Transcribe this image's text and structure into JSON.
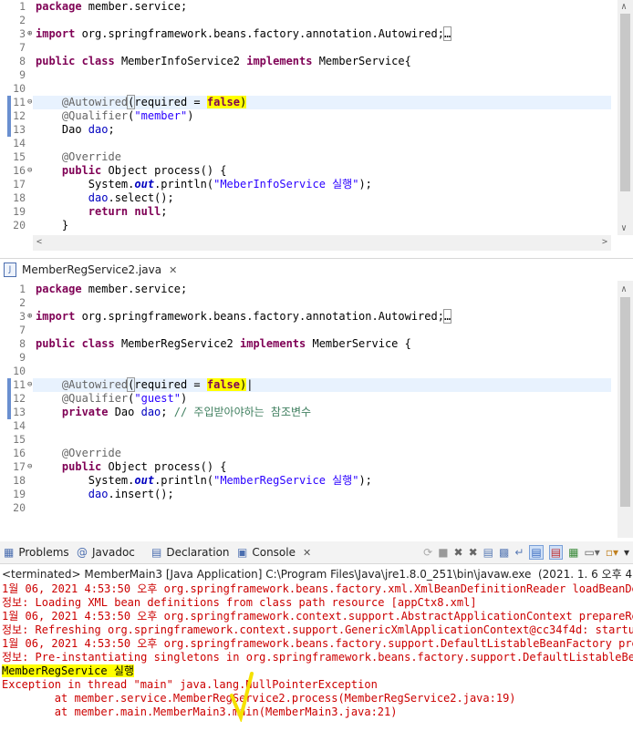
{
  "top_editor": {
    "lines": [
      {
        "n": "1",
        "segs": [
          {
            "t": "package",
            "c": "kw"
          },
          {
            "t": " member.service;"
          }
        ]
      },
      {
        "n": "2",
        "segs": []
      },
      {
        "n": "3",
        "mark": "+",
        "segs": [
          {
            "t": "import",
            "c": "kw"
          },
          {
            "t": " org.springframework.beans.factory.annotation.Autowired;"
          },
          {
            "t": "…",
            "c": "box"
          }
        ]
      },
      {
        "n": "7",
        "segs": []
      },
      {
        "n": "8",
        "segs": [
          {
            "t": "public",
            "c": "kw"
          },
          {
            "t": " "
          },
          {
            "t": "class",
            "c": "kw"
          },
          {
            "t": " MemberInfoService2 "
          },
          {
            "t": "implements",
            "c": "kw"
          },
          {
            "t": " MemberService{"
          }
        ]
      },
      {
        "n": "9",
        "segs": []
      },
      {
        "n": "10",
        "segs": []
      },
      {
        "n": "11",
        "mark": "⊖",
        "segs": [
          {
            "t": "    "
          },
          {
            "t": "@Autowired",
            "c": "ann"
          },
          {
            "t": "(",
            "c": "box"
          },
          {
            "t": "required = "
          },
          {
            "t": "false",
            "c": "kw hl"
          },
          {
            "t": ")",
            "c": "hl"
          }
        ]
      },
      {
        "n": "12",
        "segs": [
          {
            "t": "    "
          },
          {
            "t": "@Qualifier",
            "c": "ann"
          },
          {
            "t": "("
          },
          {
            "t": "\"member\"",
            "c": "str"
          },
          {
            "t": ")"
          }
        ]
      },
      {
        "n": "13",
        "segs": [
          {
            "t": "    Dao "
          },
          {
            "t": "dao",
            "c": "fld"
          },
          {
            "t": ";"
          }
        ]
      },
      {
        "n": "14",
        "segs": []
      },
      {
        "n": "15",
        "segs": [
          {
            "t": "    "
          },
          {
            "t": "@Override",
            "c": "ann"
          }
        ]
      },
      {
        "n": "16",
        "mark": "⊖",
        "segs": [
          {
            "t": "    "
          },
          {
            "t": "public",
            "c": "kw"
          },
          {
            "t": " Object process() {"
          }
        ]
      },
      {
        "n": "17",
        "segs": [
          {
            "t": "        System."
          },
          {
            "t": "out",
            "c": "sfld"
          },
          {
            "t": ".println("
          },
          {
            "t": "\"MeberInfoService 실행\"",
            "c": "str"
          },
          {
            "t": ");"
          }
        ]
      },
      {
        "n": "18",
        "segs": [
          {
            "t": "        "
          },
          {
            "t": "dao",
            "c": "fld"
          },
          {
            "t": ".select();"
          }
        ]
      },
      {
        "n": "19",
        "segs": [
          {
            "t": "        "
          },
          {
            "t": "return",
            "c": "kw"
          },
          {
            "t": " "
          },
          {
            "t": "null",
            "c": "kw"
          },
          {
            "t": ";"
          }
        ]
      },
      {
        "n": "20",
        "segs": [
          {
            "t": "    }"
          }
        ]
      }
    ]
  },
  "bottom_tab": {
    "label": "MemberRegService2.java",
    "close": "✕"
  },
  "bottom_editor": {
    "lines": [
      {
        "n": "1",
        "segs": [
          {
            "t": "package",
            "c": "kw"
          },
          {
            "t": " member.service;"
          }
        ]
      },
      {
        "n": "2",
        "segs": []
      },
      {
        "n": "3",
        "mark": "+",
        "segs": [
          {
            "t": "import",
            "c": "kw"
          },
          {
            "t": " org.springframework.beans.factory.annotation.Autowired;"
          },
          {
            "t": "…",
            "c": "box"
          }
        ]
      },
      {
        "n": "7",
        "segs": []
      },
      {
        "n": "8",
        "segs": [
          {
            "t": "public",
            "c": "kw"
          },
          {
            "t": " "
          },
          {
            "t": "class",
            "c": "kw"
          },
          {
            "t": " MemberRegService2 "
          },
          {
            "t": "implements",
            "c": "kw"
          },
          {
            "t": " MemberService {"
          }
        ]
      },
      {
        "n": "9",
        "segs": []
      },
      {
        "n": "10",
        "segs": []
      },
      {
        "n": "11",
        "mark": "⊖",
        "segs": [
          {
            "t": "    "
          },
          {
            "t": "@Autowired",
            "c": "ann"
          },
          {
            "t": "(",
            "c": "box"
          },
          {
            "t": "required = "
          },
          {
            "t": "false",
            "c": "kw hl"
          },
          {
            "t": ")",
            "c": "hl"
          },
          {
            "t": "|"
          }
        ]
      },
      {
        "n": "12",
        "segs": [
          {
            "t": "    "
          },
          {
            "t": "@Qualifier",
            "c": "ann"
          },
          {
            "t": "("
          },
          {
            "t": "\"guest\"",
            "c": "str"
          },
          {
            "t": ")"
          }
        ]
      },
      {
        "n": "13",
        "segs": [
          {
            "t": "    "
          },
          {
            "t": "private",
            "c": "kw"
          },
          {
            "t": " Dao "
          },
          {
            "t": "dao",
            "c": "fld"
          },
          {
            "t": "; "
          },
          {
            "t": "// 주입받아야하는 참조변수",
            "c": "cm"
          }
        ]
      },
      {
        "n": "14",
        "segs": []
      },
      {
        "n": "15",
        "segs": []
      },
      {
        "n": "16",
        "segs": [
          {
            "t": "    "
          },
          {
            "t": "@Override",
            "c": "ann"
          }
        ]
      },
      {
        "n": "17",
        "mark": "⊖",
        "segs": [
          {
            "t": "    "
          },
          {
            "t": "public",
            "c": "kw"
          },
          {
            "t": " Object process() {"
          }
        ]
      },
      {
        "n": "18",
        "segs": [
          {
            "t": "        System."
          },
          {
            "t": "out",
            "c": "sfld"
          },
          {
            "t": ".println("
          },
          {
            "t": "\"MemberRegService 실행\"",
            "c": "str"
          },
          {
            "t": ");"
          }
        ]
      },
      {
        "n": "19",
        "segs": [
          {
            "t": "        "
          },
          {
            "t": "dao",
            "c": "fld"
          },
          {
            "t": ".insert();"
          }
        ]
      },
      {
        "n": "20",
        "segs": []
      }
    ]
  },
  "console_tabs": [
    {
      "label": "Problems",
      "icon": "problems-icon"
    },
    {
      "label": "Javadoc",
      "icon": "javadoc-icon"
    },
    {
      "label": "Declaration",
      "icon": "declaration-icon"
    },
    {
      "label": "Console",
      "icon": "console-icon",
      "active": true
    }
  ],
  "console_close": "✕",
  "terminated_line": "<terminated> MemberMain3 [Java Application] C:\\Program Files\\Java\\jre1.8.0_251\\bin\\javaw.exe  (2021. 1. 6 오후 4:53:49 -",
  "console_lines": [
    {
      "t": "1월 06, 2021 4:53:50 오후 org.springframework.beans.factory.xml.XmlBeanDefinitionReader loadBeanDefini",
      "c": "red"
    },
    {
      "t": "정보: Loading XML bean definitions from class path resource [appCtx8.xml]",
      "c": "red"
    },
    {
      "t": "1월 06, 2021 4:53:50 오후 org.springframework.context.support.AbstractApplicationContext prepareRefres",
      "c": "red"
    },
    {
      "t": "정보: Refreshing org.springframework.context.support.GenericXmlApplicationContext@cc34f4d: startup d",
      "c": "red"
    },
    {
      "t": "1월 06, 2021 4:53:50 오후 org.springframework.beans.factory.support.DefaultListableBeanFactory preInst",
      "c": "red"
    },
    {
      "t": "정보: Pre-instantiating singletons in org.springframework.beans.factory.support.DefaultListableBeanF",
      "c": "red"
    },
    {
      "t": "MemberRegService 실행",
      "c": "hl"
    },
    {
      "t": "Exception in thread \"main\" java.lang.NullPointerException",
      "c": "red"
    },
    {
      "t": "        at member.service.MemberRegService2.process(MemberRegService2.java:19)",
      "c": "red"
    },
    {
      "t": "        at member.main.MemberMain3.main(MemberMain3.java:21)",
      "c": "red"
    }
  ]
}
